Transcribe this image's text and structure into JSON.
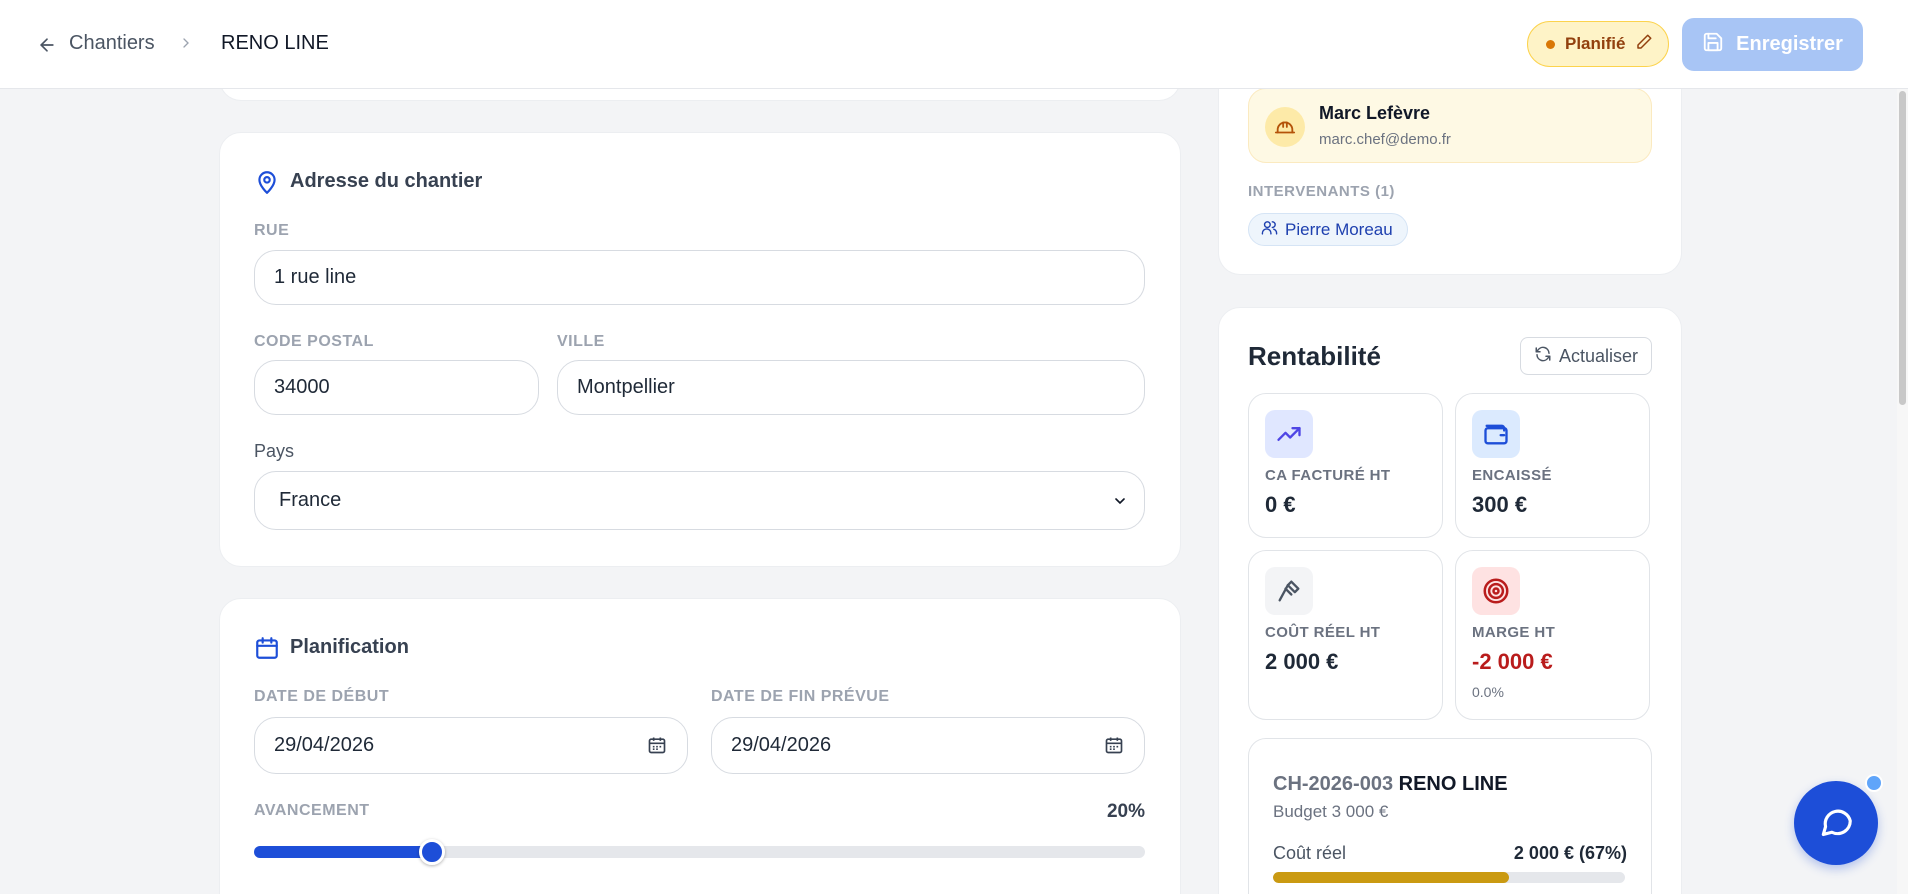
{
  "header": {
    "breadcrumb_parent": "Chantiers",
    "breadcrumb_current": "RENO LINE",
    "status_label": "Planifié",
    "save_label": "Enregistrer"
  },
  "address": {
    "title": "Adresse du chantier",
    "street_label": "RUE",
    "street_value": "1 rue line",
    "postal_label": "CODE POSTAL",
    "postal_value": "34000",
    "city_label": "VILLE",
    "city_value": "Montpellier",
    "country_label": "Pays",
    "country_value": "France"
  },
  "planning": {
    "title": "Planification",
    "start_label": "DATE DE DÉBUT",
    "start_value": "29/04/2026",
    "end_label": "DATE DE FIN PRÉVUE",
    "end_value": "29/04/2026",
    "progress_label": "AVANCEMENT",
    "progress_text": "20%",
    "progress_percent": 20
  },
  "team": {
    "chef_name": "Marc Lefèvre",
    "chef_email": "marc.chef@demo.fr",
    "intervenants_label": "INTERVENANTS (1)",
    "intervenants": [
      "Pierre Moreau"
    ]
  },
  "rentabilite": {
    "title": "Rentabilité",
    "refresh_label": "Actualiser",
    "kpis": [
      {
        "label": "CA FACTURÉ HT",
        "value": "0 €",
        "icon": "trending-up-icon",
        "sub": ""
      },
      {
        "label": "ENCAISSÉ",
        "value": "300 €",
        "icon": "wallet-icon",
        "sub": ""
      },
      {
        "label": "COÛT RÉEL HT",
        "value": "2 000 €",
        "icon": "hammer-icon",
        "sub": ""
      },
      {
        "label": "MARGE HT",
        "value": "-2 000 €",
        "icon": "target-icon",
        "sub": "0.0%"
      }
    ],
    "project_code": "CH-2026-003",
    "project_name": "RENO LINE",
    "budget_text": "Budget 3 000 €",
    "cost_label": "Coût réel",
    "cost_value": "2 000 € (67%)",
    "cost_percent": 67
  },
  "colors": {
    "accent": "#1d4ed8",
    "negative": "#b91c1c",
    "cost_bar": "#ca9a12"
  }
}
